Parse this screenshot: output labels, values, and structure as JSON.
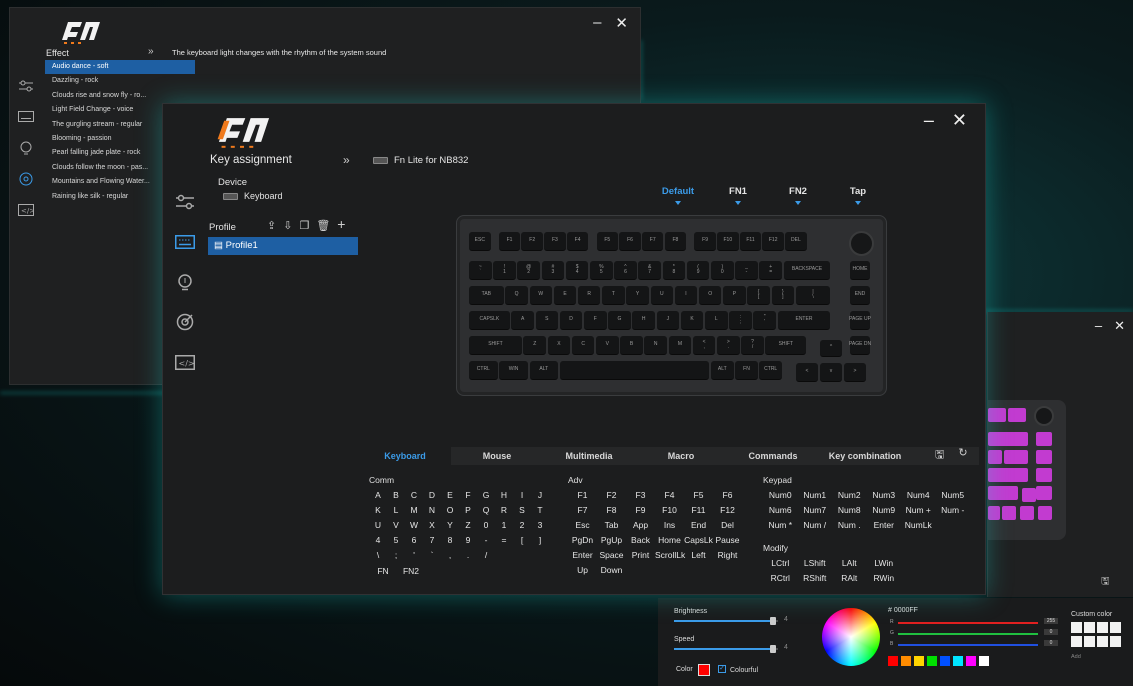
{
  "colors": {
    "accent": "#3b9be8",
    "selection": "#1e5fa3",
    "glow": "#1ee0d8"
  },
  "back_window": {
    "section_title": "Effect",
    "description": "The keyboard light changes with the rhythm of the system sound",
    "effects": [
      "Audio dance - soft",
      "Dazzling - rock",
      "Clouds rise and snow fly - ro...",
      "Light Field Change - voice",
      "The gurgling stream - regular",
      "Blooming - passion",
      "Pearl falling jade plate - rock",
      "Clouds follow the moon - pas...",
      "Mountains and Flowing Water...",
      "Raining like silk - regular"
    ]
  },
  "main_window": {
    "section_title": "Key assignment",
    "device_name": "Fn Lite for NB832",
    "device_label": "Device",
    "device_item": "Keyboard",
    "profile_label": "Profile",
    "profile_item": "Profile1",
    "layer_tabs": [
      "Default",
      "FN1",
      "FN2",
      "Tap"
    ],
    "bottom_tabs": [
      "Keyboard",
      "Mouse",
      "Multimedia",
      "Macro",
      "Commands",
      "Key combination"
    ],
    "groups": {
      "comm": {
        "title": "Comm",
        "keys": [
          "A",
          "B",
          "C",
          "D",
          "E",
          "F",
          "G",
          "H",
          "I",
          "J",
          "K",
          "L",
          "M",
          "N",
          "O",
          "P",
          "Q",
          "R",
          "S",
          "T",
          "U",
          "V",
          "W",
          "X",
          "Y",
          "Z",
          "0",
          "1",
          "2",
          "3",
          "4",
          "5",
          "6",
          "7",
          "8",
          "9",
          "-",
          "=",
          "[",
          "]",
          "\\",
          ";",
          "'",
          "`",
          ",",
          ".",
          "/"
        ],
        "extra": [
          "FN",
          "FN2"
        ]
      },
      "adv": {
        "title": "Adv",
        "keys": [
          "F1",
          "F2",
          "F3",
          "F4",
          "F5",
          "F6",
          "F7",
          "F8",
          "F9",
          "F10",
          "F11",
          "F12",
          "Esc",
          "Tab",
          "App",
          "Ins",
          "End",
          "Del",
          "PgDn",
          "PgUp",
          "Back",
          "Home",
          "CapsLk",
          "Pause",
          "Enter",
          "Space",
          "Print",
          "ScrollLk",
          "Left",
          "Right",
          "Up",
          "Down"
        ]
      },
      "keypad": {
        "title": "Keypad",
        "keys": [
          "Num0",
          "Num1",
          "Num2",
          "Num3",
          "Num4",
          "Num5",
          "Num6",
          "Num7",
          "Num8",
          "Num9",
          "Num +",
          "Num -",
          "Num *",
          "Num /",
          "Num .",
          "Enter",
          "NumLk"
        ]
      },
      "modify": {
        "title": "Modify",
        "keys": [
          "LCtrl",
          "LShift",
          "LAlt",
          "LWin",
          "RCtrl",
          "RShift",
          "RAlt",
          "RWin"
        ]
      }
    }
  },
  "keyboard": {
    "rows": [
      [
        [
          "ESC",
          1
        ]
      ],
      [
        [
          "~\n`",
          1
        ],
        [
          "!\n1",
          1
        ],
        [
          "@\n2",
          1
        ],
        [
          "#\n3",
          1
        ],
        [
          "$\n4",
          1
        ],
        [
          "%\n5",
          1
        ],
        [
          "^\n6",
          1
        ],
        [
          "&\n7",
          1
        ],
        [
          "*\n8",
          1
        ],
        [
          "(\n9",
          1
        ],
        [
          ")\n0",
          1
        ],
        [
          "_\n-",
          1
        ],
        [
          "+\n=",
          1
        ],
        [
          "BACKSPACE",
          2
        ]
      ],
      [
        [
          "TAB",
          1.5
        ],
        [
          "Q",
          1
        ],
        [
          "W",
          1
        ],
        [
          "E",
          1
        ],
        [
          "R",
          1
        ],
        [
          "T",
          1
        ],
        [
          "Y",
          1
        ],
        [
          "U",
          1
        ],
        [
          "I",
          1
        ],
        [
          "O",
          1
        ],
        [
          "P",
          1
        ],
        [
          "{\n[",
          1
        ],
        [
          "}\n]",
          1
        ],
        [
          "|\n\\",
          1.5
        ]
      ],
      [
        [
          "CAPSLK",
          1.75
        ],
        [
          "A",
          1
        ],
        [
          "S",
          1
        ],
        [
          "D",
          1
        ],
        [
          "F",
          1
        ],
        [
          "G",
          1
        ],
        [
          "H",
          1
        ],
        [
          "J",
          1
        ],
        [
          "K",
          1
        ],
        [
          "L",
          1
        ],
        [
          ":\n;",
          1
        ],
        [
          "\"\n'",
          1
        ],
        [
          "ENTER",
          2.25
        ]
      ],
      [
        [
          "SHIFT",
          2.25
        ],
        [
          "Z",
          1
        ],
        [
          "X",
          1
        ],
        [
          "C",
          1
        ],
        [
          "V",
          1
        ],
        [
          "B",
          1
        ],
        [
          "N",
          1
        ],
        [
          "M",
          1
        ],
        [
          "<\n,",
          1
        ],
        [
          ">\n.",
          1
        ],
        [
          "?\n/",
          1
        ],
        [
          "SHIFT",
          1.75
        ]
      ],
      [
        [
          "CTRL",
          1.25
        ],
        [
          "WIN",
          1.25
        ],
        [
          "ALT",
          1.25
        ],
        [
          "",
          6.25
        ],
        [
          "ALT",
          1
        ],
        [
          "FN",
          1
        ],
        [
          "CTRL",
          1
        ]
      ]
    ],
    "frow": [
      "ESC",
      "F1",
      "F2",
      "F3",
      "F4",
      "F5",
      "F6",
      "F7",
      "F8",
      "F9",
      "F10",
      "F11",
      "F12",
      "DEL"
    ],
    "right_col": [
      "HOME",
      "END",
      "PAGE UP",
      "PAGE DN"
    ],
    "arrows": [
      "^",
      "<",
      "v",
      ">"
    ]
  },
  "lighting": {
    "brightness_label": "Brightness",
    "brightness_value": "4",
    "brightness_fraction": 0.95,
    "speed_label": "Speed",
    "speed_value": "4",
    "speed_fraction": 0.95,
    "hex": "# 0000FF",
    "r_label": "R",
    "r_value": "255",
    "g_label": "G",
    "g_value": "0",
    "b_label": "B",
    "b_value": "0",
    "color_label": "Color",
    "colourful_label": "Colourful",
    "custom_color_label": "Custom color",
    "add_label": "Add",
    "preset_colors": [
      "#ff0000",
      "#ff8c00",
      "#ffd400",
      "#00e000",
      "#0050ff",
      "#00e5ff",
      "#ff00ff",
      "#ffffff"
    ]
  }
}
